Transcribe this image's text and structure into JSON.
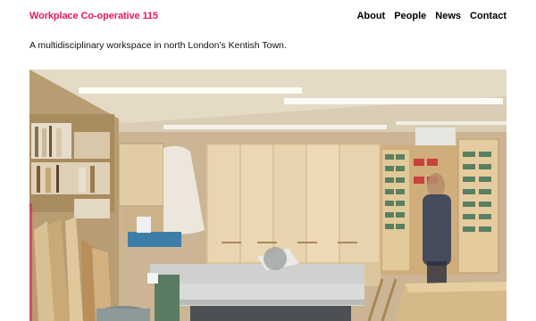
{
  "site": {
    "title": "Workplace Co-operative 115",
    "brand_color": "#e8185a"
  },
  "nav": {
    "items": [
      {
        "label": "About"
      },
      {
        "label": "People"
      },
      {
        "label": "News"
      },
      {
        "label": "Contact"
      }
    ]
  },
  "intro": {
    "tagline": "A multidisciplinary workspace in north London's Kentish Town."
  },
  "hero": {
    "subject": "workshop-photo"
  }
}
